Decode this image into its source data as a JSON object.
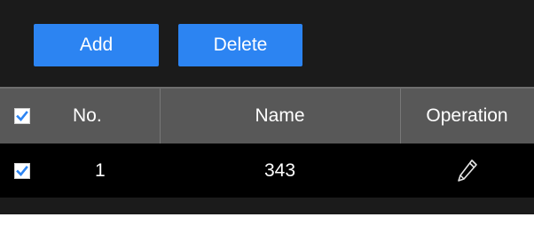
{
  "toolbar": {
    "add_label": "Add",
    "delete_label": "Delete"
  },
  "table": {
    "headers": {
      "no": "No.",
      "name": "Name",
      "operation": "Operation"
    },
    "select_all_checked": true,
    "rows": [
      {
        "checked": true,
        "no": "1",
        "name": "343",
        "operation_icon": "edit-pencil-icon"
      }
    ]
  },
  "colors": {
    "accent": "#2c84f2",
    "panel_bg": "#1b1b1b",
    "header_bg": "#585858",
    "row_bg": "#000000",
    "check_color": "#2c84f2"
  }
}
